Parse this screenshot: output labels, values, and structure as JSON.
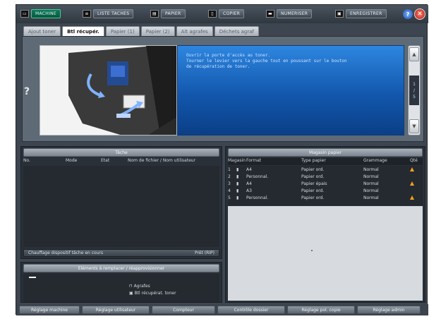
{
  "topbar": {
    "items": [
      {
        "label": "MACHINE",
        "icon": "machine-icon"
      },
      {
        "label": "LISTE TACHES",
        "icon": "job-list-icon"
      },
      {
        "label": "PAPIER",
        "icon": "paper-icon"
      },
      {
        "label": "COPIER",
        "icon": "copy-icon"
      },
      {
        "label": "NUMERISER",
        "icon": "scan-icon"
      },
      {
        "label": "ENREGISTRER",
        "icon": "store-icon"
      }
    ],
    "help": "?",
    "close": "✕"
  },
  "tabs": [
    "Ajout toner",
    "Btl récupér.",
    "Papier (1)",
    "Papier (2)",
    "Alt agrafes",
    "Déchets agraf"
  ],
  "guide": {
    "help_mark": "?",
    "message": "Ouvrir la porte d'accès au toner.\nTourner le levier vers la gauche tout en poussant sur le bouton\nde récupération de toner.",
    "page": "1",
    "page_total": "5",
    "up": "▲",
    "down": "▼"
  },
  "jobs": {
    "title": "Tâche",
    "columns": [
      "No.",
      "Mode",
      "Etat",
      "Nom de fichier / Nom utilisateur"
    ],
    "status_label": "Chauffage dispositif tâche en cours",
    "status_value": "Prêt (RIP)"
  },
  "consumables": {
    "title": "Eléments à remplacer / réapprovisionner",
    "line": "—",
    "items": [
      "Agrafes",
      "Btl récupérat. toner"
    ]
  },
  "trays": {
    "title": "Magasin papier",
    "columns": [
      "Magasin",
      "Format",
      "Type papier",
      "Grammage",
      "Qté"
    ],
    "rows": [
      {
        "no": "1",
        "icon": "▮",
        "format": "A4",
        "type": "Papier ord.",
        "weight": "Normal",
        "warn": true
      },
      {
        "no": "2",
        "icon": "▮",
        "format": "Personnal.",
        "type": "Papier ord.",
        "weight": "Normal",
        "warn": false
      },
      {
        "no": "3",
        "icon": "▮",
        "format": "A4",
        "type": "Papier épais",
        "weight": "Normal",
        "warn": true
      },
      {
        "no": "4",
        "icon": "▮",
        "format": "A3",
        "type": "Papier ord.",
        "weight": "Normal",
        "warn": false
      },
      {
        "no": "5",
        "icon": "▮",
        "format": "Personnal.",
        "type": "Papier ord.",
        "weight": "Normal",
        "warn": true
      }
    ]
  },
  "bottom": [
    "Réglage machine",
    "Réglage utilisateur",
    "Compteur",
    "Contrôle dossier",
    "Réglage pol. copie",
    "Réglage admin"
  ]
}
